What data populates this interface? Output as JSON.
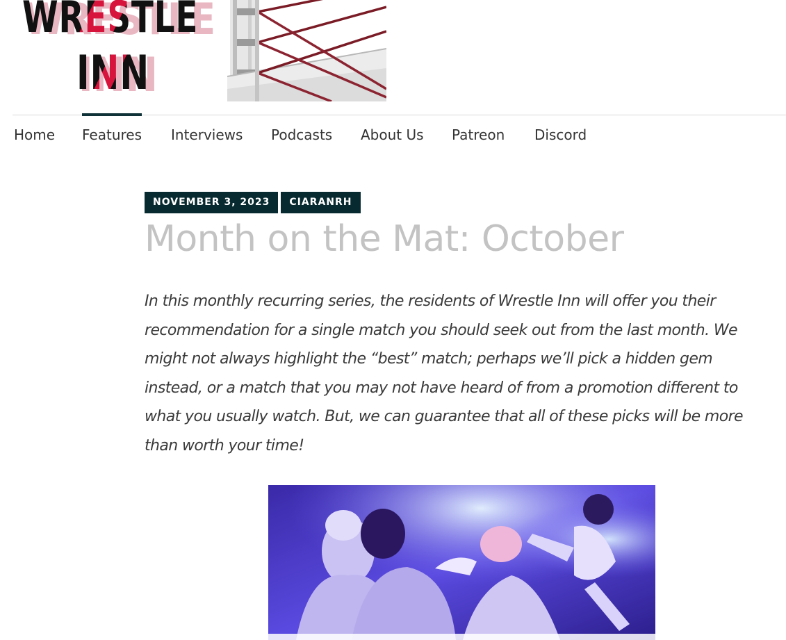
{
  "site": {
    "logo_line1": "WRESTLE",
    "logo_line2": "INN"
  },
  "nav": {
    "items": [
      {
        "label": "Home"
      },
      {
        "label": "Features"
      },
      {
        "label": "Interviews"
      },
      {
        "label": "Podcasts"
      },
      {
        "label": "About Us"
      },
      {
        "label": "Patreon"
      },
      {
        "label": "Discord"
      }
    ],
    "active": "Features"
  },
  "post": {
    "date": "November 3, 2023",
    "author": "CIARANRH",
    "title": "Month on the Mat: October",
    "intro": "In this monthly recurring series, the residents of Wrestle Inn will offer you their recommendation for a single match you should seek out from the last month. We might not always highlight the “best” match; perhaps we’ll pick a hidden gem instead, or a match that you may not have heard of from a promotion different to what you usually watch. But, we can guarantee that all of these picks will be more than worth your time!"
  },
  "colors": {
    "nav_accent": "#0e3237",
    "badge_bg": "#062a30",
    "title": "#c3c3c3",
    "logo_red": "#d7143c"
  },
  "icons": {
    "header_art": "wrestling-ring-ropes",
    "feature_image": "wrestling-match-photo"
  }
}
